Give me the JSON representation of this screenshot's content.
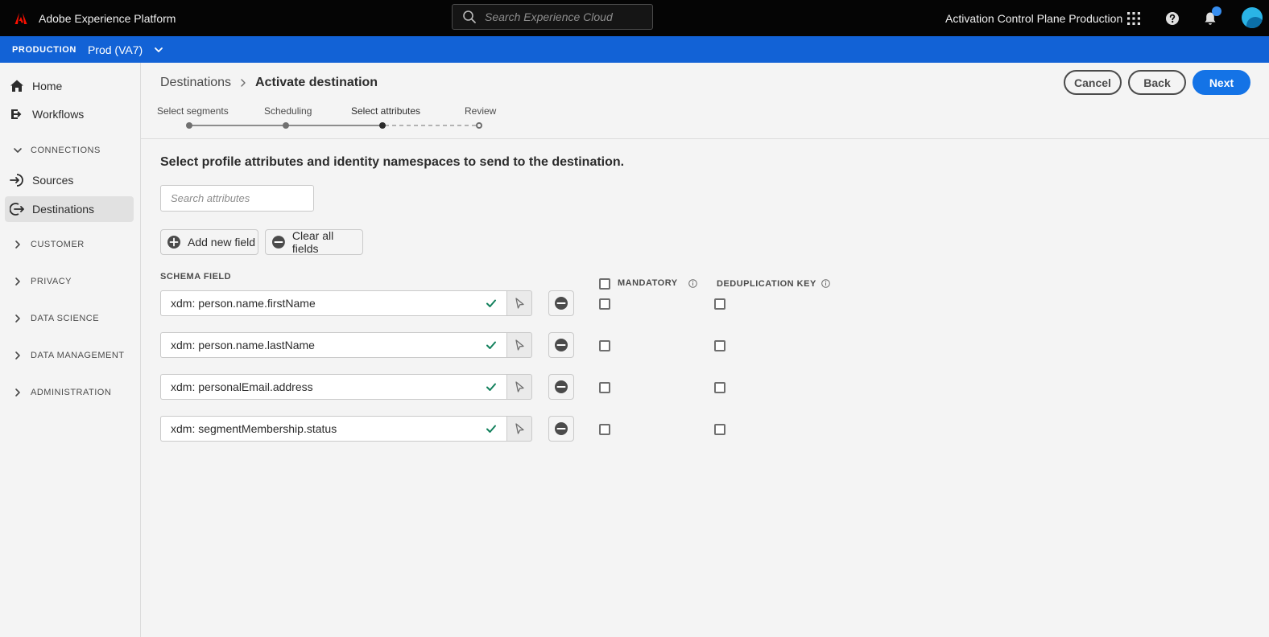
{
  "app": {
    "name": "Adobe Experience Platform",
    "brand_color": "#FA0F00",
    "search_placeholder": "Search Experience Cloud",
    "org_name": "Activation Control Plane Production"
  },
  "sandbox": {
    "type": "PRODUCTION",
    "name": "Prod (VA7)",
    "bar_color": "#1262D6"
  },
  "sidebar": {
    "items": [
      {
        "label": "Home",
        "icon": "home-icon"
      },
      {
        "label": "Workflows",
        "icon": "workflows-icon"
      },
      {
        "label": "Sources",
        "icon": "sources-icon"
      },
      {
        "label": "Destinations",
        "icon": "destinations-icon",
        "active": true
      }
    ],
    "sections": {
      "connections": "CONNECTIONS",
      "customer": "CUSTOMER",
      "privacy": "PRIVACY",
      "data_science": "DATA SCIENCE",
      "data_management": "DATA MANAGEMENT",
      "administration": "ADMINISTRATION"
    }
  },
  "header": {
    "breadcrumb_parent": "Destinations",
    "breadcrumb_current": "Activate destination",
    "cancel_label": "Cancel",
    "back_label": "Back",
    "next_label": "Next",
    "primary_color": "#1473E6"
  },
  "stepper": {
    "steps": [
      "Select segments",
      "Scheduling",
      "Select attributes",
      "Review"
    ],
    "current_step": 3
  },
  "content": {
    "instruction": "Select profile attributes and identity namespaces to send to the destination.",
    "search_placeholder": "Search attributes",
    "add_field_label": "Add new field",
    "clear_fields_label": "Clear all fields",
    "columns": {
      "schema_field": "SCHEMA FIELD",
      "mandatory": "MANDATORY",
      "dedup_key": "DEDUPLICATION KEY"
    },
    "fields": [
      {
        "value": "xdm: person.name.firstName",
        "mandatory": false,
        "dedup": false
      },
      {
        "value": "xdm: person.name.lastName",
        "mandatory": false,
        "dedup": false
      },
      {
        "value": "xdm: personalEmail.address",
        "mandatory": false,
        "dedup": false
      },
      {
        "value": "xdm: segmentMembership.status",
        "mandatory": false,
        "dedup": false
      }
    ],
    "valid_color": "#12805C"
  }
}
